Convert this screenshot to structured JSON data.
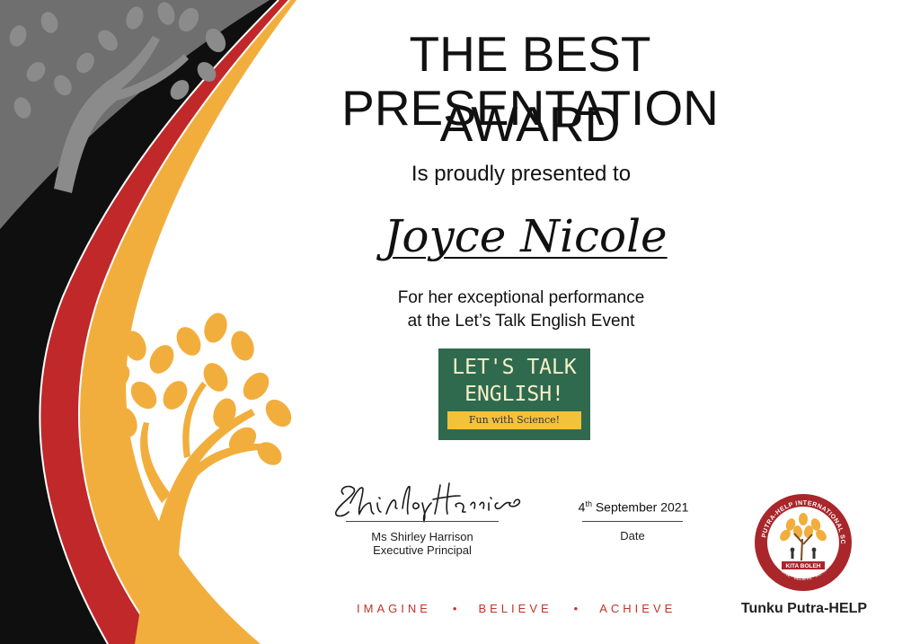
{
  "certificate": {
    "title_line1": "THE BEST PRESENTATION",
    "title_line2": "AWARD",
    "presented_text": "Is proudly presented to",
    "recipient": "Joyce Nicole",
    "reason_line1": "For her exceptional performance",
    "reason_line2": "at the Let’s Talk English Event"
  },
  "event_logo": {
    "line1": "LET'S TALK",
    "line2": "ENGLISH!",
    "tagline": "Fun with Science!"
  },
  "signatory": {
    "signature_text": "Shirley Harrison",
    "name": "Ms Shirley Harrison",
    "title": "Executive Principal"
  },
  "date": {
    "day": "4",
    "suffix": "th",
    "rest": " September 2021",
    "label": "Date"
  },
  "motto": {
    "word1": "IMAGINE",
    "separator": "•",
    "word2": "BELIEVE",
    "word3": "ACHIEVE"
  },
  "school": {
    "name": "Tunku Putra-HELP",
    "seal_top_text": "TUNKU PUTRA-HELP INTERNATIONAL SCHOOL",
    "seal_motto": "KITA BOLEH",
    "seal_bottom_text": "IMAGINE · BELIEVE · ACHIEVE"
  },
  "colors": {
    "gray_band": "#6f6f6f",
    "black_band": "#0f0f0f",
    "red_band": "#c0282a",
    "gold_band": "#f2ae3d",
    "event_green": "#2f6a4f",
    "event_yellow": "#f2c23a",
    "motto_red": "#c0342a",
    "seal_red": "#a9262b"
  },
  "icons": [
    "tree-silhouette-icon",
    "tree-leaves-icon",
    "school-seal-icon"
  ]
}
